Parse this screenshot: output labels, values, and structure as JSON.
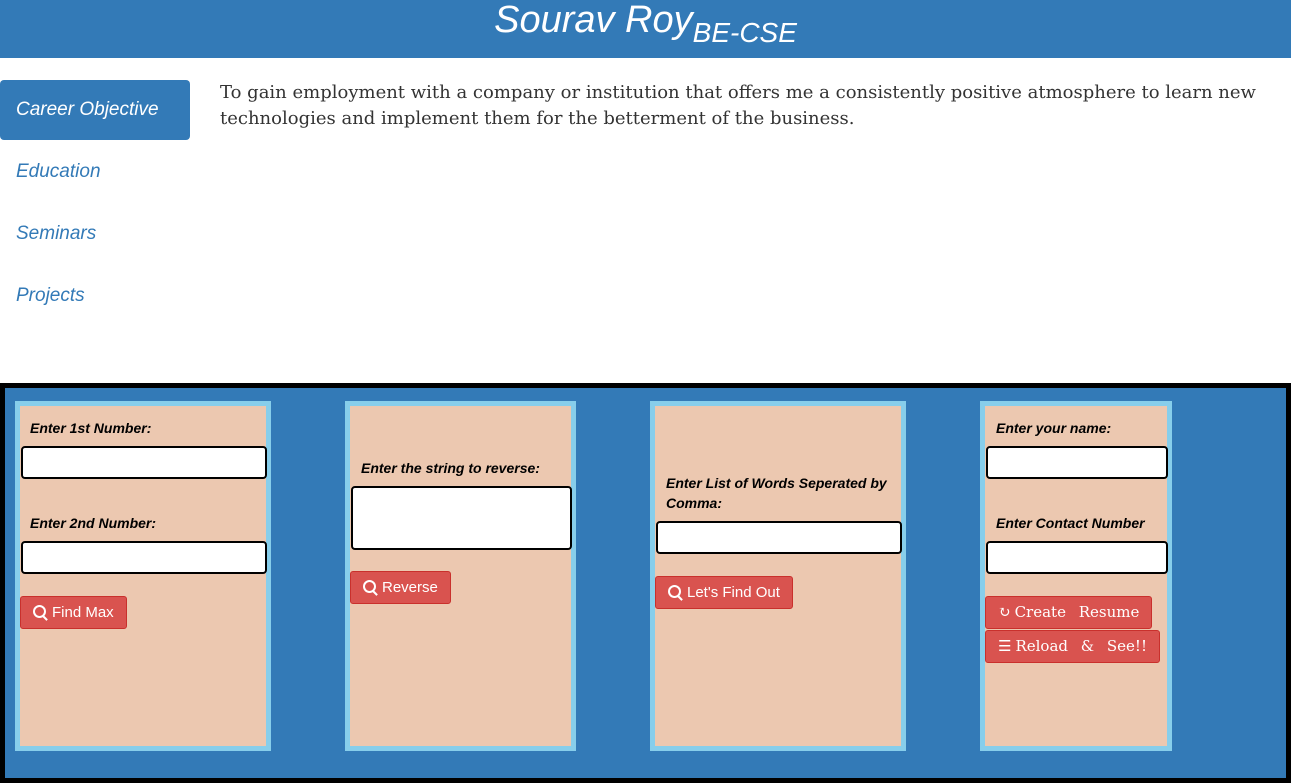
{
  "header": {
    "name": "Sourav Roy",
    "degree": "BE-CSE"
  },
  "sidebar": {
    "items": [
      {
        "label": "Career Objective"
      },
      {
        "label": "Education"
      },
      {
        "label": "Seminars"
      },
      {
        "label": "Projects"
      }
    ]
  },
  "content": {
    "objective": "To gain employment with a company or institution that offers me a consistently positive atmosphere to learn new technologies and implement them for the betterment of the business."
  },
  "cards": {
    "max": {
      "label1": "Enter 1st Number:",
      "label2": "Enter 2nd Number:",
      "button": "Find Max"
    },
    "reverse": {
      "label": "Enter the string to reverse:",
      "button": "Reverse"
    },
    "words": {
      "label": "Enter List of Words Seperated by Comma:",
      "button": "Let's Find Out"
    },
    "resume": {
      "label1": "Enter your name:",
      "label2": "Enter Contact Number",
      "button1": "Create Resume",
      "button2": "Reload & See!!"
    }
  },
  "colors": {
    "primary": "#337ab7",
    "card": "#ecc8b0",
    "card_border": "#87ceeb",
    "button": "#d9534f"
  },
  "icons": [
    "search-icon",
    "refresh-icon",
    "list-icon"
  ]
}
